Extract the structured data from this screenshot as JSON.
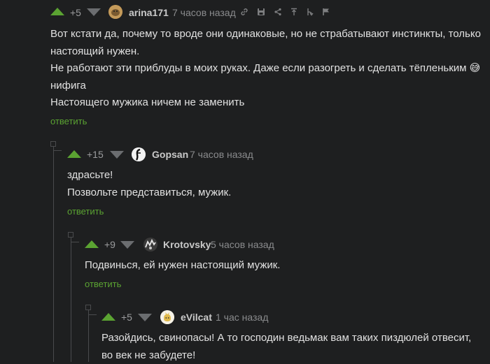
{
  "comments": [
    {
      "rating": "+5",
      "author": "arina171",
      "time": "7 часов назад",
      "lines": [
        "Вот кстати да, почему то вроде они одинаковые, но не страбатывают инстинкты, только",
        "настоящий нужен.",
        "Не работают эти приблуды в моих руках. Даже если разогреть и сделать тёпленьким",
        "нифига",
        "Настоящего мужика ничем не заменить"
      ],
      "emoji": "😅",
      "reply": "ответить",
      "tools": [
        {
          "icon": "link-icon",
          "glyph": "🔗"
        },
        {
          "icon": "save-icon",
          "glyph": "▣"
        },
        {
          "icon": "share-icon",
          "glyph": "<"
        },
        {
          "icon": "go-to-top-icon",
          "glyph": "⤒"
        },
        {
          "icon": "branch-icon",
          "glyph": "⤷"
        },
        {
          "icon": "flag-icon",
          "glyph": "⚑"
        }
      ]
    },
    {
      "rating": "+15",
      "author": "Gopsan",
      "time": "7 часов назад",
      "lines": [
        "здрасьте!",
        "Позвольте представиться, мужик."
      ],
      "reply": "ответить"
    },
    {
      "rating": "+9",
      "author": "Krotovsky",
      "time": "5 часов назад",
      "lines": [
        "Подвинься, ей нужен настоящий мужик."
      ],
      "reply": "ответить"
    },
    {
      "rating": "+5",
      "author": "eVilcat",
      "time": "1 час назад",
      "lines": [
        "Разойдись, свинопасы! А то господин ведьмак вам таких пиздюлей отвесит,",
        "во век не забудете!"
      ]
    }
  ],
  "colors": {
    "background": "#1e1f20",
    "upvote": "#5ba332",
    "downvote": "#6b6d70",
    "reply": "#5ba332"
  }
}
